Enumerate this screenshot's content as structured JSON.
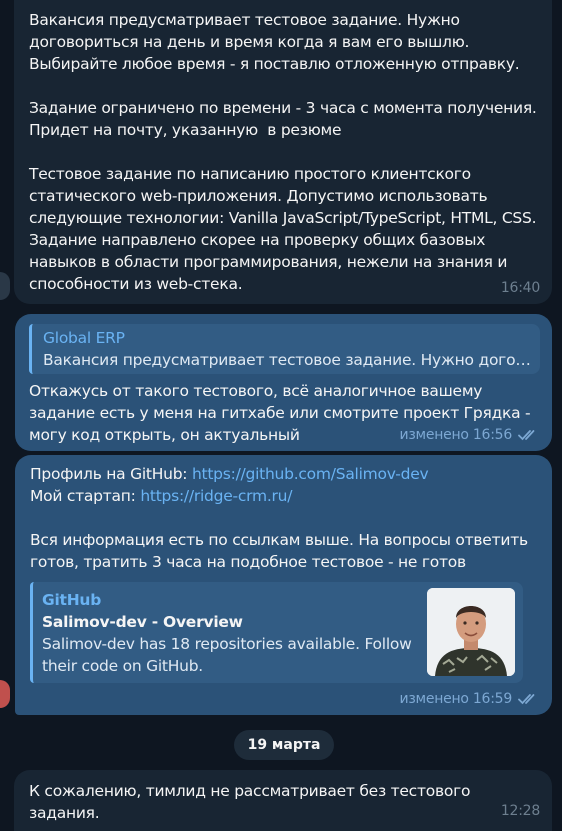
{
  "messages": {
    "m1": {
      "text": "Вакансия предусматривает тестовое задание. Нужно договориться на день и время когда я вам его вышлю. Выбирайте любое время - я поставлю отложенную отправку.\n\nЗадание ограничено по времени - 3 часа с момента получения. Придет на почту, указанную  в резюме\n\nТестовое задание по написанию простого клиентского статического web-приложения. Допустимо использовать следующие технологии: Vanilla JavaScript/TypeScript, HTML, CSS. Задание направлено скорее на проверку общих базовых навыков в области программирования, нежели на знания и способности из web-стека.",
      "time": "16:40"
    },
    "m2": {
      "reply_name": "Global ERP",
      "reply_text": "Вакансия предусматривает тестовое задание. Нужно договориться на день и время когда я вам его вышлю.",
      "text": "Откажусь от такого тестового, всё аналогичное вашему задание есть у меня на гитхабе или смотрите проект Грядка - могу код открыть, он актуальный",
      "time": "изменено 16:56"
    },
    "m3": {
      "github_prefix": "Профиль на GitHub: ",
      "github_url": "https://github.com/Salimov-dev",
      "startup_prefix": "Мой стартап: ",
      "startup_url": "https://ridge-crm.ru/",
      "text": "Вся информация есть по ссылкам выше. На вопросы ответить готов, тратить 3 часа на подобное тестовое - не готов",
      "preview": {
        "site": "GitHub",
        "title": "Salimov-dev - Overview",
        "description": "Salimov-dev has 18 repositories available. Follow their code on GitHub."
      },
      "time": "изменено 16:59"
    },
    "date_separator": "19 марта",
    "m4": {
      "text": "К сожалению, тимлид не рассматривает без тестового задания.",
      "time": "12:28"
    }
  },
  "colors": {
    "background": "#0e1621",
    "incoming_bubble": "#182533",
    "outgoing_bubble": "#2b5278",
    "link": "#6ab3f3"
  }
}
